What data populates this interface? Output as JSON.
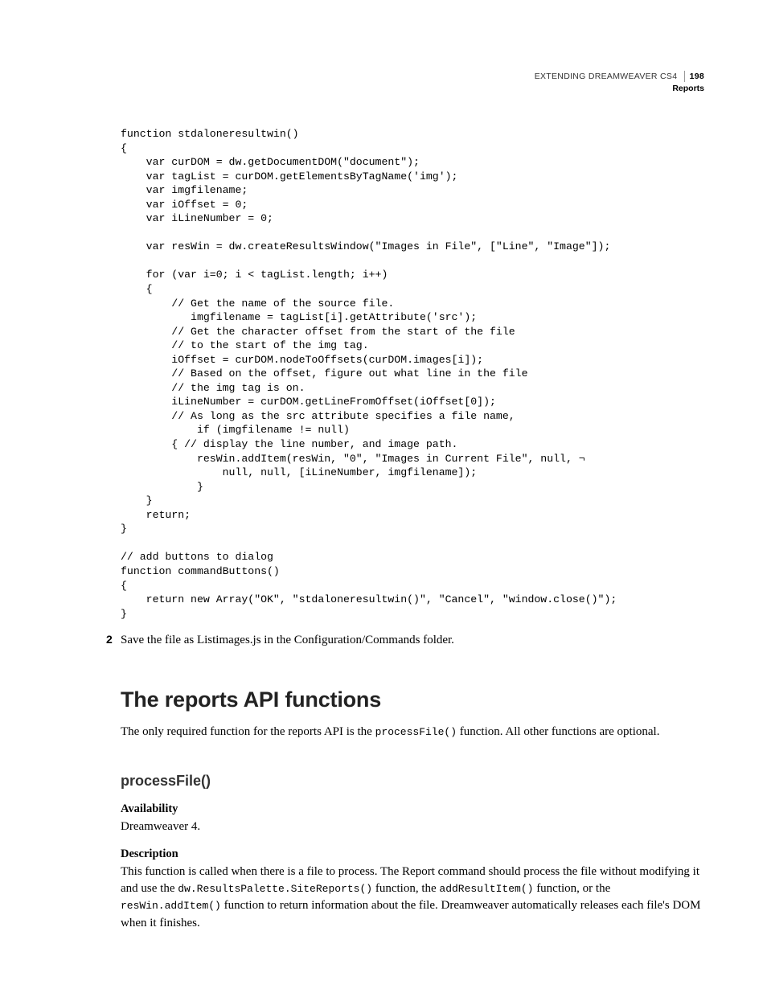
{
  "header": {
    "book_title": "EXTENDING DREAMWEAVER CS4",
    "page_number": "198",
    "chapter": "Reports"
  },
  "code_block": "function stdaloneresultwin()\n{\n    var curDOM = dw.getDocumentDOM(\"document\");\n    var tagList = curDOM.getElementsByTagName('img');\n    var imgfilename;\n    var iOffset = 0;\n    var iLineNumber = 0;\n\n    var resWin = dw.createResultsWindow(\"Images in File\", [\"Line\", \"Image\"]);\n\n    for (var i=0; i < tagList.length; i++)\n    {\n        // Get the name of the source file.\n           imgfilename = tagList[i].getAttribute('src');\n        // Get the character offset from the start of the file\n        // to the start of the img tag.\n        iOffset = curDOM.nodeToOffsets(curDOM.images[i]);\n        // Based on the offset, figure out what line in the file\n        // the img tag is on.\n        iLineNumber = curDOM.getLineFromOffset(iOffset[0]);\n        // As long as the src attribute specifies a file name,\n            if (imgfilename != null)\n        { // display the line number, and image path.\n            resWin.addItem(resWin, \"0\", \"Images in Current File\", null, ¬\n                null, null, [iLineNumber, imgfilename]);\n            }\n    }\n    return;\n}\n\n// add buttons to dialog\nfunction commandButtons()\n{\n    return new Array(\"OK\", \"stdaloneresultwin()\", \"Cancel\", \"window.close()\");\n}",
  "step2": {
    "num": "2",
    "text": "Save the file as Listimages.js in the Configuration/Commands folder."
  },
  "h1": "The reports API functions",
  "intro": {
    "pre": "The only required function for the reports API is the ",
    "code": "processFile()",
    "post": " function. All other functions are optional."
  },
  "h2": "processFile()",
  "availability": {
    "label": "Availability",
    "text": "Dreamweaver 4."
  },
  "description": {
    "label": "Description",
    "pre": "This function is called when there is a file to process. The Report command should process the file without modifying it and use the ",
    "code1": "dw.ResultsPalette.SiteReports()",
    "mid1": " function, the ",
    "code2": "addResultItem()",
    "mid2": " function, or the ",
    "code3": "resWin.addItem()",
    "post": " function to return information about the file. Dreamweaver automatically releases each file's DOM when it finishes."
  }
}
